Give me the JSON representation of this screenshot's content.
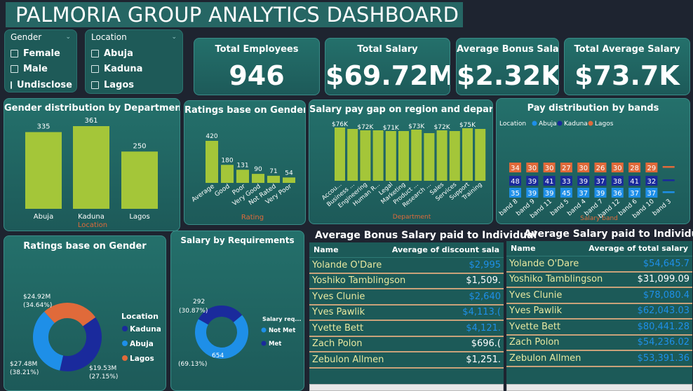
{
  "title": "PALMORIA GROUP ANALYTICS DASHBOARD",
  "slicers": {
    "gender": {
      "label": "Gender",
      "options": [
        "Female",
        "Male",
        "Undisclose"
      ]
    },
    "location": {
      "label": "Location",
      "options": [
        "Abuja",
        "Kaduna",
        "Lagos"
      ]
    }
  },
  "kpis": [
    {
      "label": "Total Employees",
      "value": "946"
    },
    {
      "label": "Total Salary",
      "value": "$69.72M"
    },
    {
      "label": "Average Bonus Salary",
      "value": "$2.32K"
    },
    {
      "label": "Total Average Salary",
      "value": "$73.7K"
    }
  ],
  "colors": {
    "bar": "#a4c639",
    "kaduna": "#1a2a9c",
    "abuja": "#1e8fe8",
    "lagos": "#e06a3a",
    "card": "#1f6463"
  },
  "chart_data": [
    {
      "type": "bar",
      "title": "Gender distribution by Department",
      "xlabel": "Location",
      "categories": [
        "Abuja",
        "Kaduna",
        "Lagos"
      ],
      "values": [
        335,
        361,
        250
      ],
      "data_labels": [
        "335",
        "361",
        "250"
      ]
    },
    {
      "type": "bar",
      "title": "Ratings base on Gender",
      "xlabel": "Rating",
      "categories": [
        "Average",
        "Good",
        "Poor",
        "Very Good",
        "Not Rated",
        "Very Poor"
      ],
      "values": [
        420,
        180,
        131,
        90,
        71,
        54
      ],
      "data_labels": [
        "420",
        "180",
        "131",
        "90",
        "71",
        "54"
      ]
    },
    {
      "type": "bar",
      "title": "Salary pay gap on region and department",
      "xlabel": "Department",
      "categories": [
        "Accou...",
        "Business ...",
        "Engineering",
        "Human R...",
        "Legal",
        "Marketing",
        "Product ...",
        "Research ...",
        "Sales",
        "Services",
        "Support",
        "Training"
      ],
      "values": [
        76,
        74,
        72,
        72,
        71,
        71,
        73,
        68,
        72,
        71,
        75,
        74
      ],
      "data_labels": [
        "$76K",
        "",
        "$72K",
        "",
        "$71K",
        "",
        "$73K",
        "",
        "$72K",
        "",
        "$75K",
        ""
      ]
    },
    {
      "type": "bar",
      "title": "Pay distribution by bands",
      "legend_title": "Location",
      "xlabel": "Salary band",
      "categories": [
        "band 8",
        "band 9",
        "band 11",
        "band 5",
        "band 4",
        "band 7",
        "band 12",
        "band 6",
        "band 10",
        "band 3"
      ],
      "series": [
        {
          "name": "Abuja",
          "values": [
            35,
            39,
            39,
            45,
            37,
            39,
            36,
            37,
            37,
            0
          ]
        },
        {
          "name": "Kaduna",
          "values": [
            48,
            39,
            41,
            33,
            39,
            37,
            38,
            41,
            32,
            0
          ]
        },
        {
          "name": "Lagos",
          "values": [
            34,
            30,
            30,
            27,
            30,
            26,
            30,
            28,
            29,
            0
          ]
        }
      ]
    },
    {
      "type": "pie",
      "title": "Ratings base on Gender",
      "legend_title": "Location",
      "categories": [
        "Kaduna",
        "Abuja",
        "Lagos"
      ],
      "values": [
        27.48,
        24.92,
        19.53
      ],
      "labels": [
        {
          "amount": "$27.48M",
          "pct": "(38.21%)"
        },
        {
          "amount": "$24.92M",
          "pct": "(34.64%)"
        },
        {
          "amount": "$19.53M",
          "pct": "(27.15%)"
        }
      ]
    },
    {
      "type": "pie",
      "title": "Salary by Requirements",
      "legend_title": "Salary req...",
      "categories": [
        "Not Met",
        "Met"
      ],
      "values": [
        654,
        292
      ],
      "labels": [
        {
          "amount": "654",
          "pct": "(69.13%)"
        },
        {
          "amount": "292",
          "pct": "(30.87%)"
        }
      ]
    }
  ],
  "tables": {
    "bonus": {
      "title": "Average Bonus Salary paid to Individual",
      "col_name": "Name",
      "col_value": "Average of discount sala",
      "rows": [
        {
          "name": "Yolande O'Dare",
          "value": "$2,995",
          "color": "#1e8fe8"
        },
        {
          "name": "Yoshiko Tamblingson",
          "value": "$1,509.",
          "color": "#ffffff"
        },
        {
          "name": "Yves Clunie",
          "value": "$2,640",
          "color": "#1e8fe8"
        },
        {
          "name": "Yves Pawlik",
          "value": "$4,113.(",
          "color": "#1e8fe8"
        },
        {
          "name": "Yvette Bett",
          "value": "$4,121.",
          "color": "#1e8fe8"
        },
        {
          "name": "Zach Polon",
          "value": "$696.(",
          "color": "#ffffff"
        },
        {
          "name": "Zebulon Allmen",
          "value": "$1,251.",
          "color": "#ffffff"
        }
      ]
    },
    "salary": {
      "title": "Average Salary paid to Individual",
      "col_name": "Name",
      "col_value": "Average of total salary",
      "rows": [
        {
          "name": "Yolande O'Dare",
          "value": "$54,645.7",
          "color": "#1e8fe8"
        },
        {
          "name": "Yoshiko Tamblingson",
          "value": "$31,099.09",
          "color": "#ffffff"
        },
        {
          "name": "Yves Clunie",
          "value": "$78,080.4",
          "color": "#1e8fe8"
        },
        {
          "name": "Yves Pawlik",
          "value": "$62,043.03",
          "color": "#1e8fe8"
        },
        {
          "name": "Yvette Bett",
          "value": "$80,441.28",
          "color": "#1e8fe8"
        },
        {
          "name": "Zach Polon",
          "value": "$54,236.02",
          "color": "#1e8fe8"
        },
        {
          "name": "Zebulon Allmen",
          "value": "$53,391.36",
          "color": "#1e8fe8"
        }
      ]
    }
  }
}
